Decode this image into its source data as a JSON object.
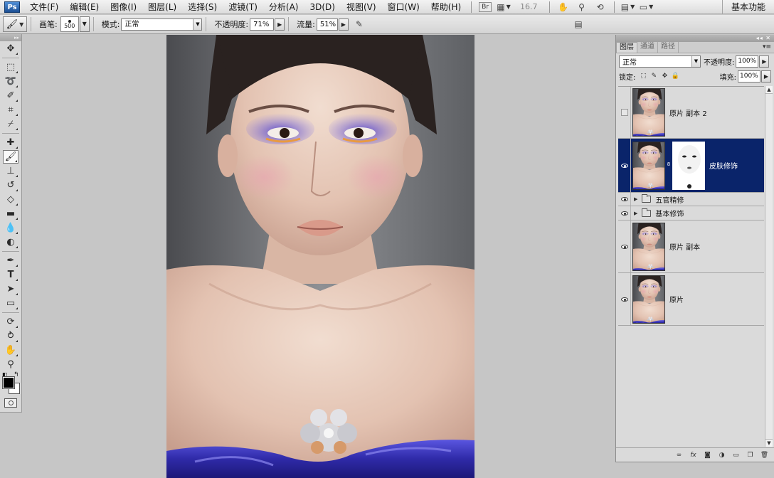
{
  "app": {
    "logo": "Ps"
  },
  "menubar": {
    "items": [
      "文件(F)",
      "编辑(E)",
      "图像(I)",
      "图层(L)",
      "选择(S)",
      "滤镜(T)",
      "分析(A)",
      "3D(D)",
      "视图(V)",
      "窗口(W)",
      "帮助(H)"
    ],
    "bridge_label": "Br",
    "zoom": "16.7",
    "workspace": "基本功能"
  },
  "options": {
    "brush_label": "画笔:",
    "brush_size": "500",
    "mode_label": "模式:",
    "mode_value": "正常",
    "opacity_label": "不透明度:",
    "opacity_value": "71%",
    "flow_label": "流量:",
    "flow_value": "51%"
  },
  "layers_panel": {
    "tabs": [
      "图层",
      "通道",
      "路径"
    ],
    "active_tab": "图层",
    "blend_mode": "正常",
    "opacity_label": "不透明度:",
    "opacity_value": "100%",
    "lock_label": "锁定:",
    "fill_label": "填充:",
    "fill_value": "100%",
    "layers": [
      {
        "name": "原片 副本 2",
        "visible": false,
        "type": "pixel",
        "selected": false
      },
      {
        "name": "皮肤修饰",
        "visible": true,
        "type": "pixel-with-mask",
        "selected": true
      },
      {
        "name": "五官精修",
        "visible": true,
        "type": "group",
        "selected": false
      },
      {
        "name": "基本修饰",
        "visible": true,
        "type": "group",
        "selected": false
      },
      {
        "name": "原片 副本",
        "visible": true,
        "type": "pixel",
        "selected": false
      },
      {
        "name": "原片",
        "visible": true,
        "type": "pixel",
        "selected": false
      }
    ]
  },
  "colors": {
    "selection": "#0a246a",
    "foreground": "#000000",
    "background": "#ffffff",
    "dress": "#3a34b8",
    "eyeshadow": "#6a5cd8"
  }
}
